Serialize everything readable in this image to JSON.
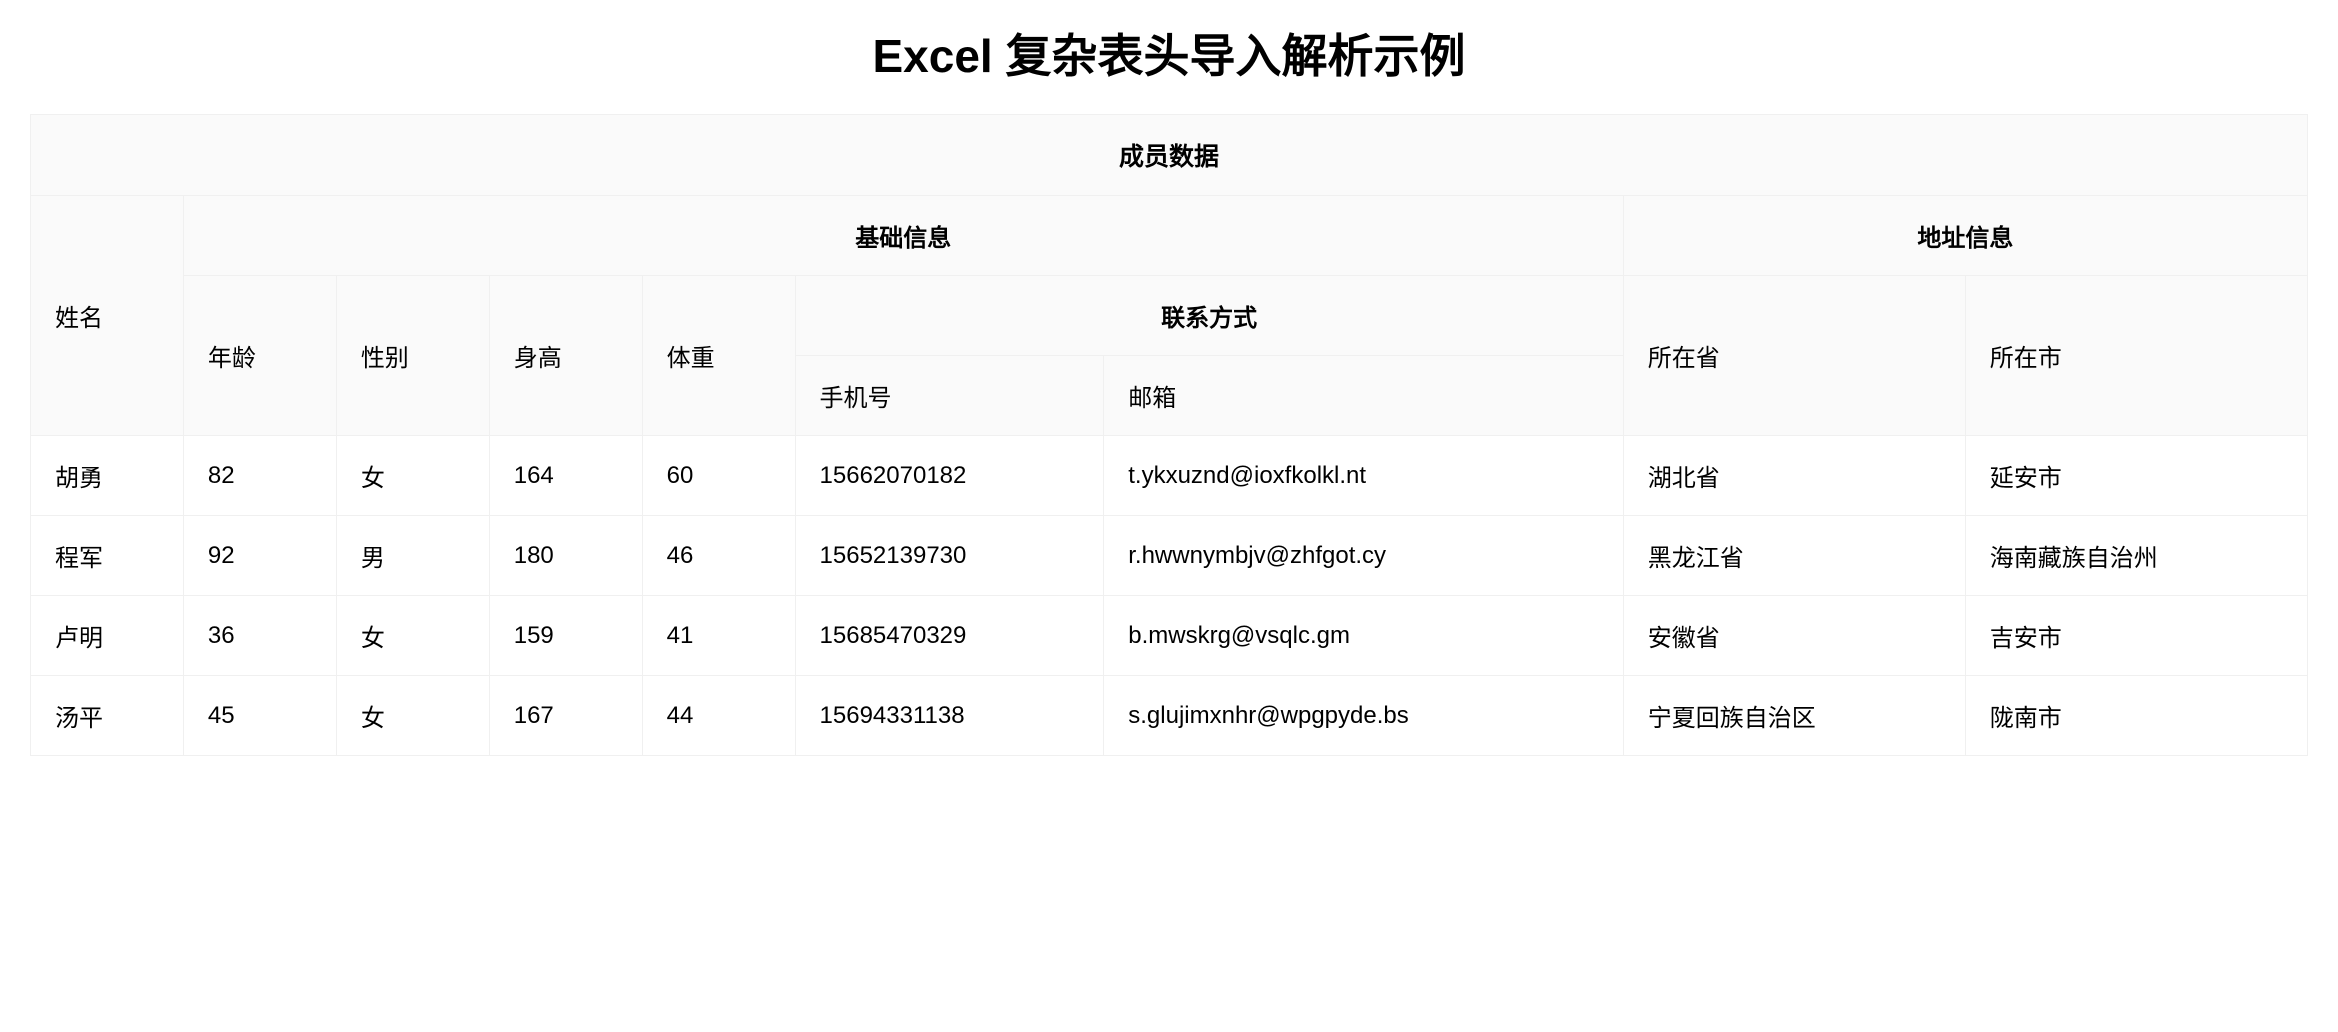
{
  "page": {
    "title": "Excel 复杂表头导入解析示例"
  },
  "table": {
    "super_header": "成员数据",
    "groups": {
      "basic": "基础信息",
      "address": "地址信息",
      "contact": "联系方式"
    },
    "columns": {
      "name": "姓名",
      "age": "年龄",
      "gender": "性别",
      "height": "身高",
      "weight": "体重",
      "phone": "手机号",
      "email": "邮箱",
      "province": "所在省",
      "city": "所在市"
    },
    "rows": [
      {
        "name": "胡勇",
        "age": "82",
        "gender": "女",
        "height": "164",
        "weight": "60",
        "phone": "15662070182",
        "email": "t.ykxuznd@ioxfkolkl.nt",
        "province": "湖北省",
        "city": "延安市"
      },
      {
        "name": "程军",
        "age": "92",
        "gender": "男",
        "height": "180",
        "weight": "46",
        "phone": "15652139730",
        "email": "r.hwwnymbjv@zhfgot.cy",
        "province": "黑龙江省",
        "city": "海南藏族自治州"
      },
      {
        "name": "卢明",
        "age": "36",
        "gender": "女",
        "height": "159",
        "weight": "41",
        "phone": "15685470329",
        "email": "b.mwskrg@vsqlc.gm",
        "province": "安徽省",
        "city": "吉安市"
      },
      {
        "name": "汤平",
        "age": "45",
        "gender": "女",
        "height": "167",
        "weight": "44",
        "phone": "15694331138",
        "email": "s.glujimxnhr@wpgpyde.bs",
        "province": "宁夏回族自治区",
        "city": "陇南市"
      }
    ]
  }
}
